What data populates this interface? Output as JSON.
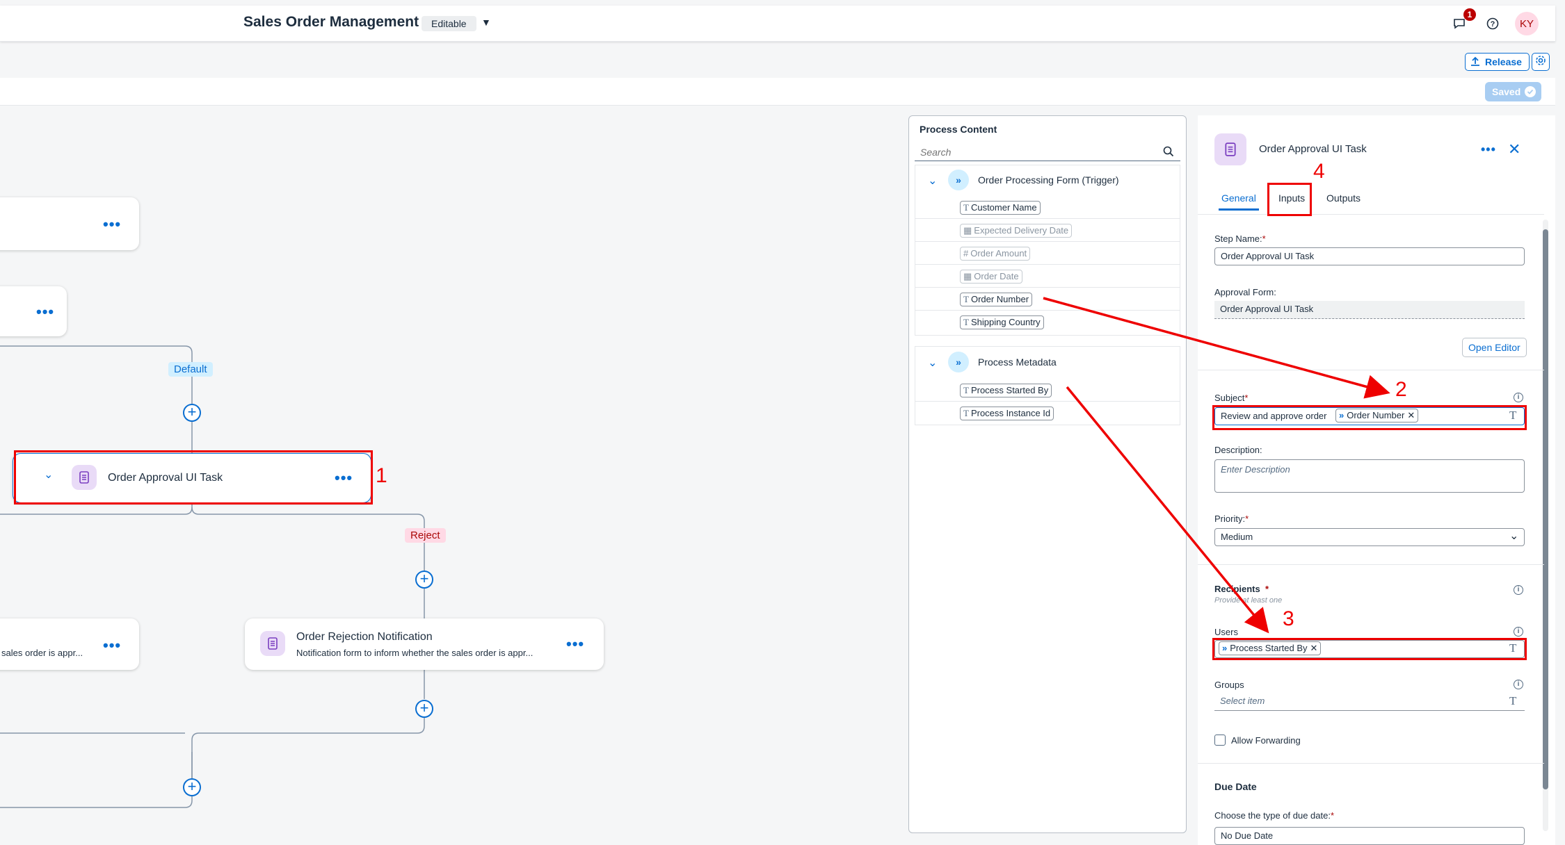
{
  "shell": {
    "title": "Sales Order Management",
    "status_badge": "Editable",
    "notification_count": "1",
    "avatar_initials": "KY"
  },
  "toolbar": {
    "release_label": "Release",
    "saved_label": "Saved"
  },
  "canvas": {
    "default_label": "Default",
    "reject_label": "Reject",
    "approval_task_title": "Order Approval UI Task",
    "left_card_desc": "sales order is appr...",
    "rejection_title": "Order Rejection Notification",
    "rejection_desc": "Notification form to inform whether the sales order is appr..."
  },
  "process_content": {
    "title": "Process Content",
    "search_placeholder": "Search",
    "groups": [
      {
        "name": "Order Processing Form (Trigger)",
        "items": [
          {
            "label": "Customer Name",
            "type_icon": "T",
            "enabled": true
          },
          {
            "label": "Expected Delivery Date",
            "type_icon": "calendar",
            "enabled": false
          },
          {
            "label": "Order Amount",
            "type_icon": "#",
            "enabled": false
          },
          {
            "label": "Order Date",
            "type_icon": "calendar",
            "enabled": false
          },
          {
            "label": "Order Number",
            "type_icon": "T",
            "enabled": true
          },
          {
            "label": "Shipping Country",
            "type_icon": "T",
            "enabled": true
          }
        ]
      },
      {
        "name": "Process Metadata",
        "items": [
          {
            "label": "Process Started By",
            "type_icon": "T",
            "enabled": true
          },
          {
            "label": "Process Instance Id",
            "type_icon": "T",
            "enabled": true
          }
        ]
      }
    ]
  },
  "properties": {
    "header_title": "Order Approval UI Task",
    "tabs": [
      "General",
      "Inputs",
      "Outputs"
    ],
    "active_tab": "General",
    "step_name_label": "Step Name:",
    "step_name_value": "Order Approval UI Task",
    "approval_form_label": "Approval Form:",
    "approval_form_value": "Order Approval UI Task",
    "open_editor_label": "Open Editor",
    "subject_label": "Subject",
    "subject_text": "Review and approve order",
    "subject_token": "Order Number",
    "description_label": "Description:",
    "description_placeholder": "Enter Description",
    "priority_label": "Priority:",
    "priority_value": "Medium",
    "recipients_label": "Recipients",
    "recipients_hint": "Provide at least one",
    "users_label": "Users",
    "users_token": "Process Started By",
    "groups_label": "Groups",
    "groups_placeholder": "Select item",
    "allow_forwarding_label": "Allow Forwarding",
    "allow_forwarding_checked": false,
    "due_date_heading": "Due Date",
    "due_date_type_label": "Choose the type of due date:",
    "due_date_value": "No Due Date"
  },
  "annotations": [
    "1",
    "2",
    "3",
    "4"
  ],
  "colors": {
    "accent": "#0a6ed1",
    "annotation_red": "#e00000",
    "reject_badge_bg": "#ffd9e5",
    "default_badge_bg": "#d1efff"
  }
}
